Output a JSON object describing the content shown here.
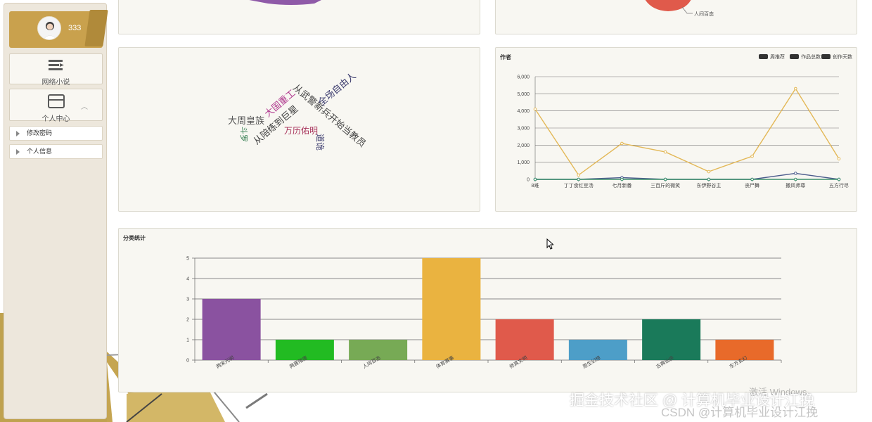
{
  "sidebar": {
    "username": "333",
    "menu": [
      {
        "label": "网络小说",
        "icon": "list-icon"
      },
      {
        "label": "个人中心",
        "icon": "card-icon",
        "expanded": true
      }
    ],
    "sub_items": [
      {
        "label": "修改密码"
      },
      {
        "label": "个人信息"
      }
    ]
  },
  "top_right_panel": {
    "visible_label": "人间百态"
  },
  "word_cloud": {
    "words": [
      {
        "text": "大周皇族",
        "color": "#555555"
      },
      {
        "text": "大国重工",
        "color": "#b0398e"
      },
      {
        "text": "从武警新兵开始当教员",
        "color": "#444444"
      },
      {
        "text": "全场自由人",
        "color": "#3c3c6e"
      },
      {
        "text": "万历佑明",
        "color": "#a7325a"
      },
      {
        "text": "从陪练到巨星",
        "color": "#3f3f3f"
      },
      {
        "text": "斗罗",
        "color": "#2d7a4b"
      },
      {
        "text": "道诡",
        "color": "#3c3c6e"
      }
    ]
  },
  "author_chart": {
    "title": "作者",
    "legend": [
      "周推荐",
      "作品总数",
      "创作天数"
    ],
    "legend_color": "#333333"
  },
  "category_chart": {
    "title": "分类统计"
  },
  "watermarks": {
    "activate": "激活 Windows",
    "juejin": "掘金技术社区 @ 计算机毕业设计江挽",
    "csdn": "CSDN @计算机毕业设计江挽"
  },
  "chart_data": [
    {
      "type": "line",
      "title": "作者",
      "categories": [
        "8难",
        "丁丁食红豆汤",
        "七月新番",
        "三百斤的微笑",
        "东伊野谷主",
        "丧尸舞",
        "撒风师尊",
        "五方行尽"
      ],
      "ylim": [
        0,
        6000
      ],
      "yticks": [
        "0",
        "1,000",
        "2,000",
        "3,000",
        "4,000",
        "5,000",
        "6,000"
      ],
      "series": [
        {
          "name": "周推荐",
          "values": [
            0,
            0,
            100,
            0,
            0,
            0,
            350,
            0
          ],
          "color": "#4b5b8c"
        },
        {
          "name": "作品总数",
          "values": [
            0,
            0,
            0,
            0,
            0,
            0,
            0,
            0
          ],
          "color": "#3a8f6a"
        },
        {
          "name": "创作天数",
          "values": [
            4100,
            250,
            2100,
            1600,
            450,
            1350,
            5300,
            1200
          ],
          "color": "#e3b857"
        }
      ],
      "grid": true
    },
    {
      "type": "bar",
      "title": "分类统计",
      "categories": [
        "两宋元明",
        "两晋隋唐",
        "人间百态",
        "体育赛事",
        "修真文明",
        "原生幻想",
        "古典仙侠",
        "东方玄幻"
      ],
      "values": [
        3,
        1,
        1,
        5,
        2,
        1,
        2,
        1
      ],
      "colors": [
        "#8a52a0",
        "#22bb22",
        "#77aa55",
        "#eab340",
        "#e05a4b",
        "#4d9ec8",
        "#1a7a5a",
        "#e86a2a"
      ],
      "ylim": [
        0,
        5
      ],
      "yticks": [
        "0",
        "1",
        "2",
        "3",
        "4",
        "5"
      ],
      "grid": true
    }
  ]
}
